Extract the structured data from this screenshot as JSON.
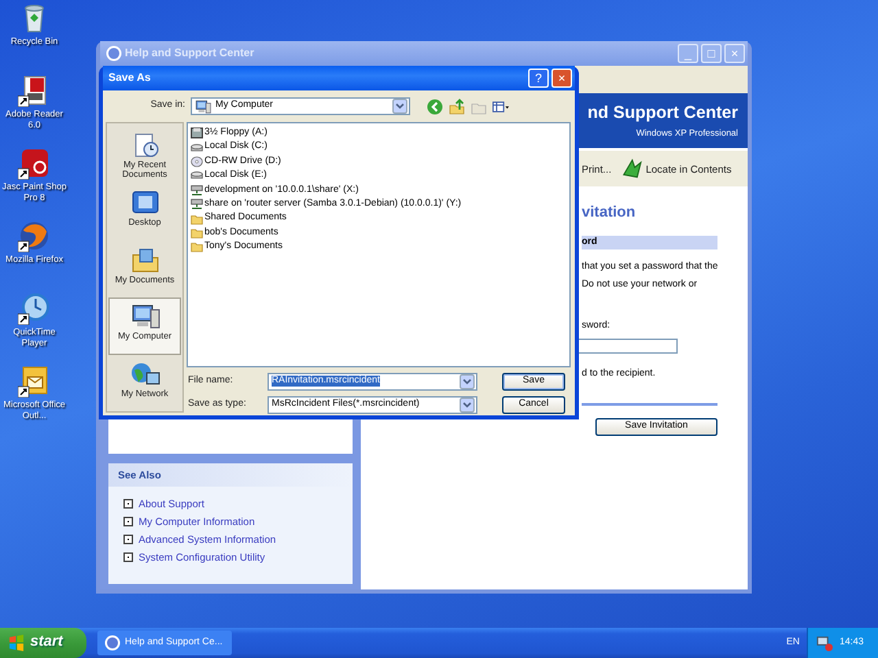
{
  "desktop_icons": [
    {
      "label": "Recycle Bin",
      "kind": "bin"
    },
    {
      "label": "Adobe Reader 6.0",
      "kind": "pdf"
    },
    {
      "label": "Jasc Paint Shop Pro 8",
      "kind": "paint"
    },
    {
      "label": "Mozilla Firefox",
      "kind": "globe"
    },
    {
      "label": "QuickTime Player",
      "kind": "player"
    },
    {
      "label": "Microsoft Office Outl...",
      "kind": "mail"
    }
  ],
  "help_window": {
    "title": "Help and Support Center",
    "title_buttons": [
      "_",
      "□",
      "×"
    ],
    "banner_title": "nd Support Center",
    "banner_subtitle": "Windows XP Professional",
    "toolbar": [
      {
        "label": "Print...",
        "kind": "text"
      },
      {
        "label": "Locate in Contents",
        "kind": "arrow"
      }
    ],
    "heading": "vitation",
    "section_title": "ord",
    "paragraph_lines": [
      "that you set a password that the",
      "Do not use your network or"
    ],
    "password_label": "sword:",
    "note": "d to the recipient.",
    "save_button": "Save Invitation",
    "see_also": {
      "title": "See Also",
      "links": [
        "About Support",
        "My Computer Information",
        "Advanced System Information",
        "System Configuration Utility"
      ]
    }
  },
  "save_dialog": {
    "title": "Save As",
    "title_buttons": [
      "?",
      "×"
    ],
    "save_in_label": "Save in:",
    "save_in_value": "My Computer",
    "places": [
      {
        "label": "My Recent Documents",
        "kind": "recent",
        "selected": false
      },
      {
        "label": "Desktop",
        "kind": "desktop",
        "selected": false
      },
      {
        "label": "My Documents",
        "kind": "documents",
        "selected": false
      },
      {
        "label": "My Computer",
        "kind": "computer",
        "selected": true
      },
      {
        "label": "My Network",
        "kind": "network",
        "selected": false
      }
    ],
    "files": [
      {
        "name": "3½ Floppy (A:)",
        "kind": "floppy"
      },
      {
        "name": "Local Disk (C:)",
        "kind": "disk"
      },
      {
        "name": "CD-RW Drive (D:)",
        "kind": "cd"
      },
      {
        "name": "Local Disk (E:)",
        "kind": "disk"
      },
      {
        "name": "development on '10.0.0.1\\share' (X:)",
        "kind": "share"
      },
      {
        "name": "share on 'router server (Samba 3.0.1-Debian) (10.0.0.1)' (Y:)",
        "kind": "share"
      },
      {
        "name": "Shared Documents",
        "kind": "folder"
      },
      {
        "name": "bob's Documents",
        "kind": "folder"
      },
      {
        "name": "Tony's Documents",
        "kind": "folder"
      }
    ],
    "file_name_label": "File name:",
    "file_name": "RAInvitation.msrcincident",
    "file_name_selected": true,
    "save_type_label": "Save as type:",
    "save_type": "MsRcIncident Files(*.msrcincident)",
    "buttons": [
      "Save",
      "Cancel"
    ]
  },
  "taskbar": {
    "start": "start",
    "tasks": [
      {
        "label": "Help and Support Ce...",
        "selected": false
      }
    ],
    "language": "EN",
    "clock": "14:43"
  }
}
